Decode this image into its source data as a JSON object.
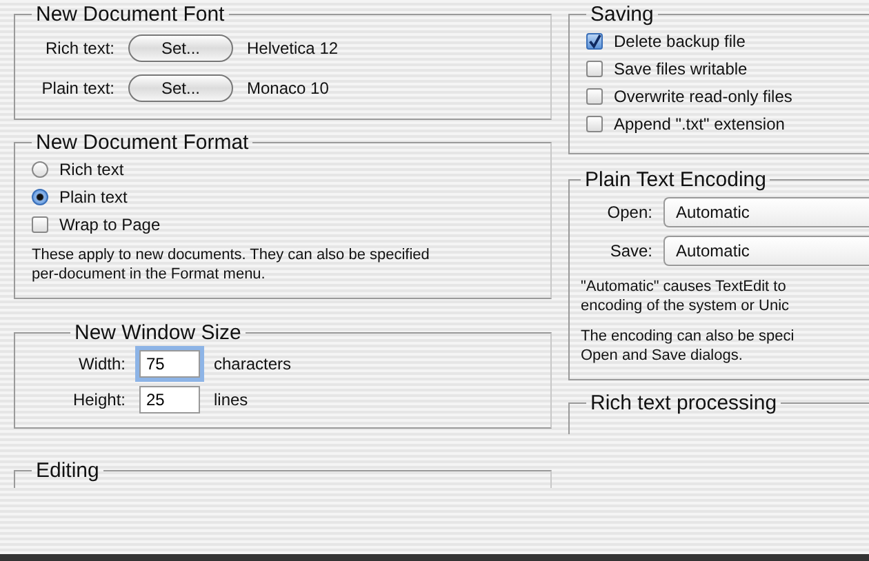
{
  "new_document_font": {
    "title": "New Document Font",
    "rows": [
      {
        "label": "Rich text:",
        "button": "Set...",
        "font": "Helvetica 12"
      },
      {
        "label": "Plain text:",
        "button": "Set...",
        "font": "Monaco 10"
      }
    ]
  },
  "new_document_format": {
    "title": "New Document Format",
    "options": [
      {
        "label": "Rich text",
        "selected": false
      },
      {
        "label": "Plain text",
        "selected": true
      }
    ],
    "wrap": {
      "label": "Wrap to Page",
      "checked": false
    },
    "note": "These apply to new documents. They can also be specified per-document in the Format menu."
  },
  "new_window_size": {
    "title": "New Window Size",
    "fields": [
      {
        "label": "Width:",
        "value": "75",
        "unit": "characters",
        "focused": true
      },
      {
        "label": "Height:",
        "value": "25",
        "unit": "lines",
        "focused": false
      }
    ]
  },
  "editing": {
    "title": "Editing"
  },
  "saving": {
    "title": "Saving",
    "options": [
      {
        "label": "Delete backup file",
        "checked": true
      },
      {
        "label": "Save files writable",
        "checked": false
      },
      {
        "label": "Overwrite read-only files",
        "checked": false
      },
      {
        "label": "Append \".txt\" extension",
        "checked": false
      }
    ]
  },
  "plain_text_encoding": {
    "title": "Plain Text Encoding",
    "popups": [
      {
        "label": "Open:",
        "value": "Automatic"
      },
      {
        "label": "Save:",
        "value": "Automatic"
      }
    ],
    "notes": [
      [
        "\"Automatic\" causes TextEdit to",
        "encoding of the system or Unic"
      ],
      [
        "The encoding can also be speci",
        "Open and Save dialogs."
      ]
    ]
  },
  "rich_text_processing": {
    "title": "Rich text processing"
  }
}
